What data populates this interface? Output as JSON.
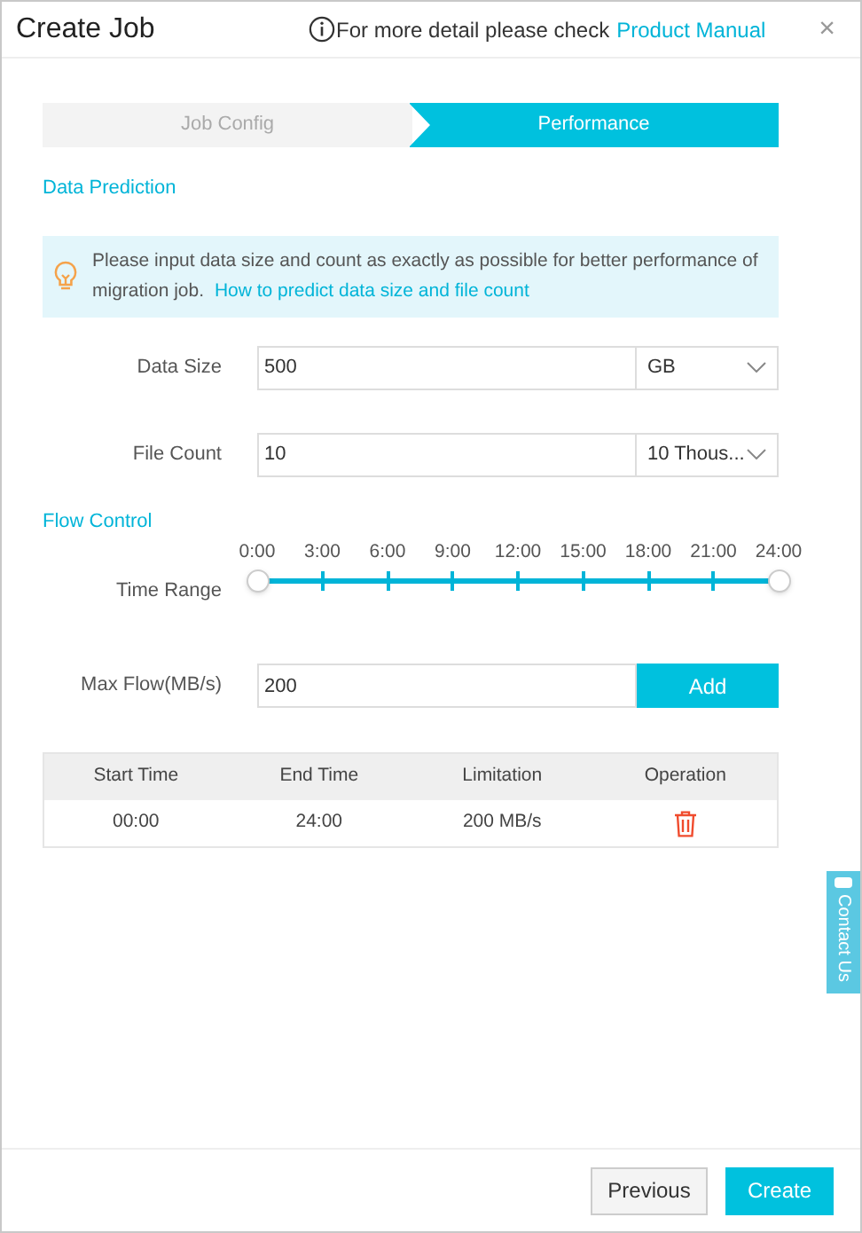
{
  "dialog": {
    "title": "Create Job",
    "help_text": "For more detail please check",
    "help_link": "Product Manual",
    "close": "×"
  },
  "steps": [
    {
      "label": "Job Config",
      "selected": false
    },
    {
      "label": "Performance",
      "selected": true
    }
  ],
  "data_prediction": {
    "heading": "Data Prediction",
    "tip": "Please input data size and count as exactly as possible for better performance of migration job.",
    "tip_link": "How to predict data size and file count",
    "fields": [
      {
        "label": "Data Size",
        "value": "500",
        "unit": "GB"
      },
      {
        "label": "File Count",
        "value": "10",
        "unit": "10 Thous..."
      }
    ]
  },
  "flow_control": {
    "heading": "Flow Control",
    "slider": {
      "label": "Time Range",
      "ticks": [
        "0:00",
        "3:00",
        "6:00",
        "9:00",
        "12:00",
        "15:00",
        "18:00",
        "21:00",
        "24:00"
      ],
      "level": 1
    },
    "max_flow": {
      "label": "Max Flow(MB/s)",
      "value": "200",
      "button": "Add"
    },
    "table": {
      "columns": [
        "Start Time",
        "End Time",
        "Limitation",
        "Operation"
      ],
      "rows": [
        {
          "cells": [
            "00:00",
            "24:00",
            "200 MB/s"
          ]
        }
      ]
    }
  },
  "contact_tab": "Contact Us",
  "buttons": [
    {
      "label": "Previous",
      "kind": "secondary"
    },
    {
      "label": "Create",
      "kind": "primary"
    }
  ]
}
